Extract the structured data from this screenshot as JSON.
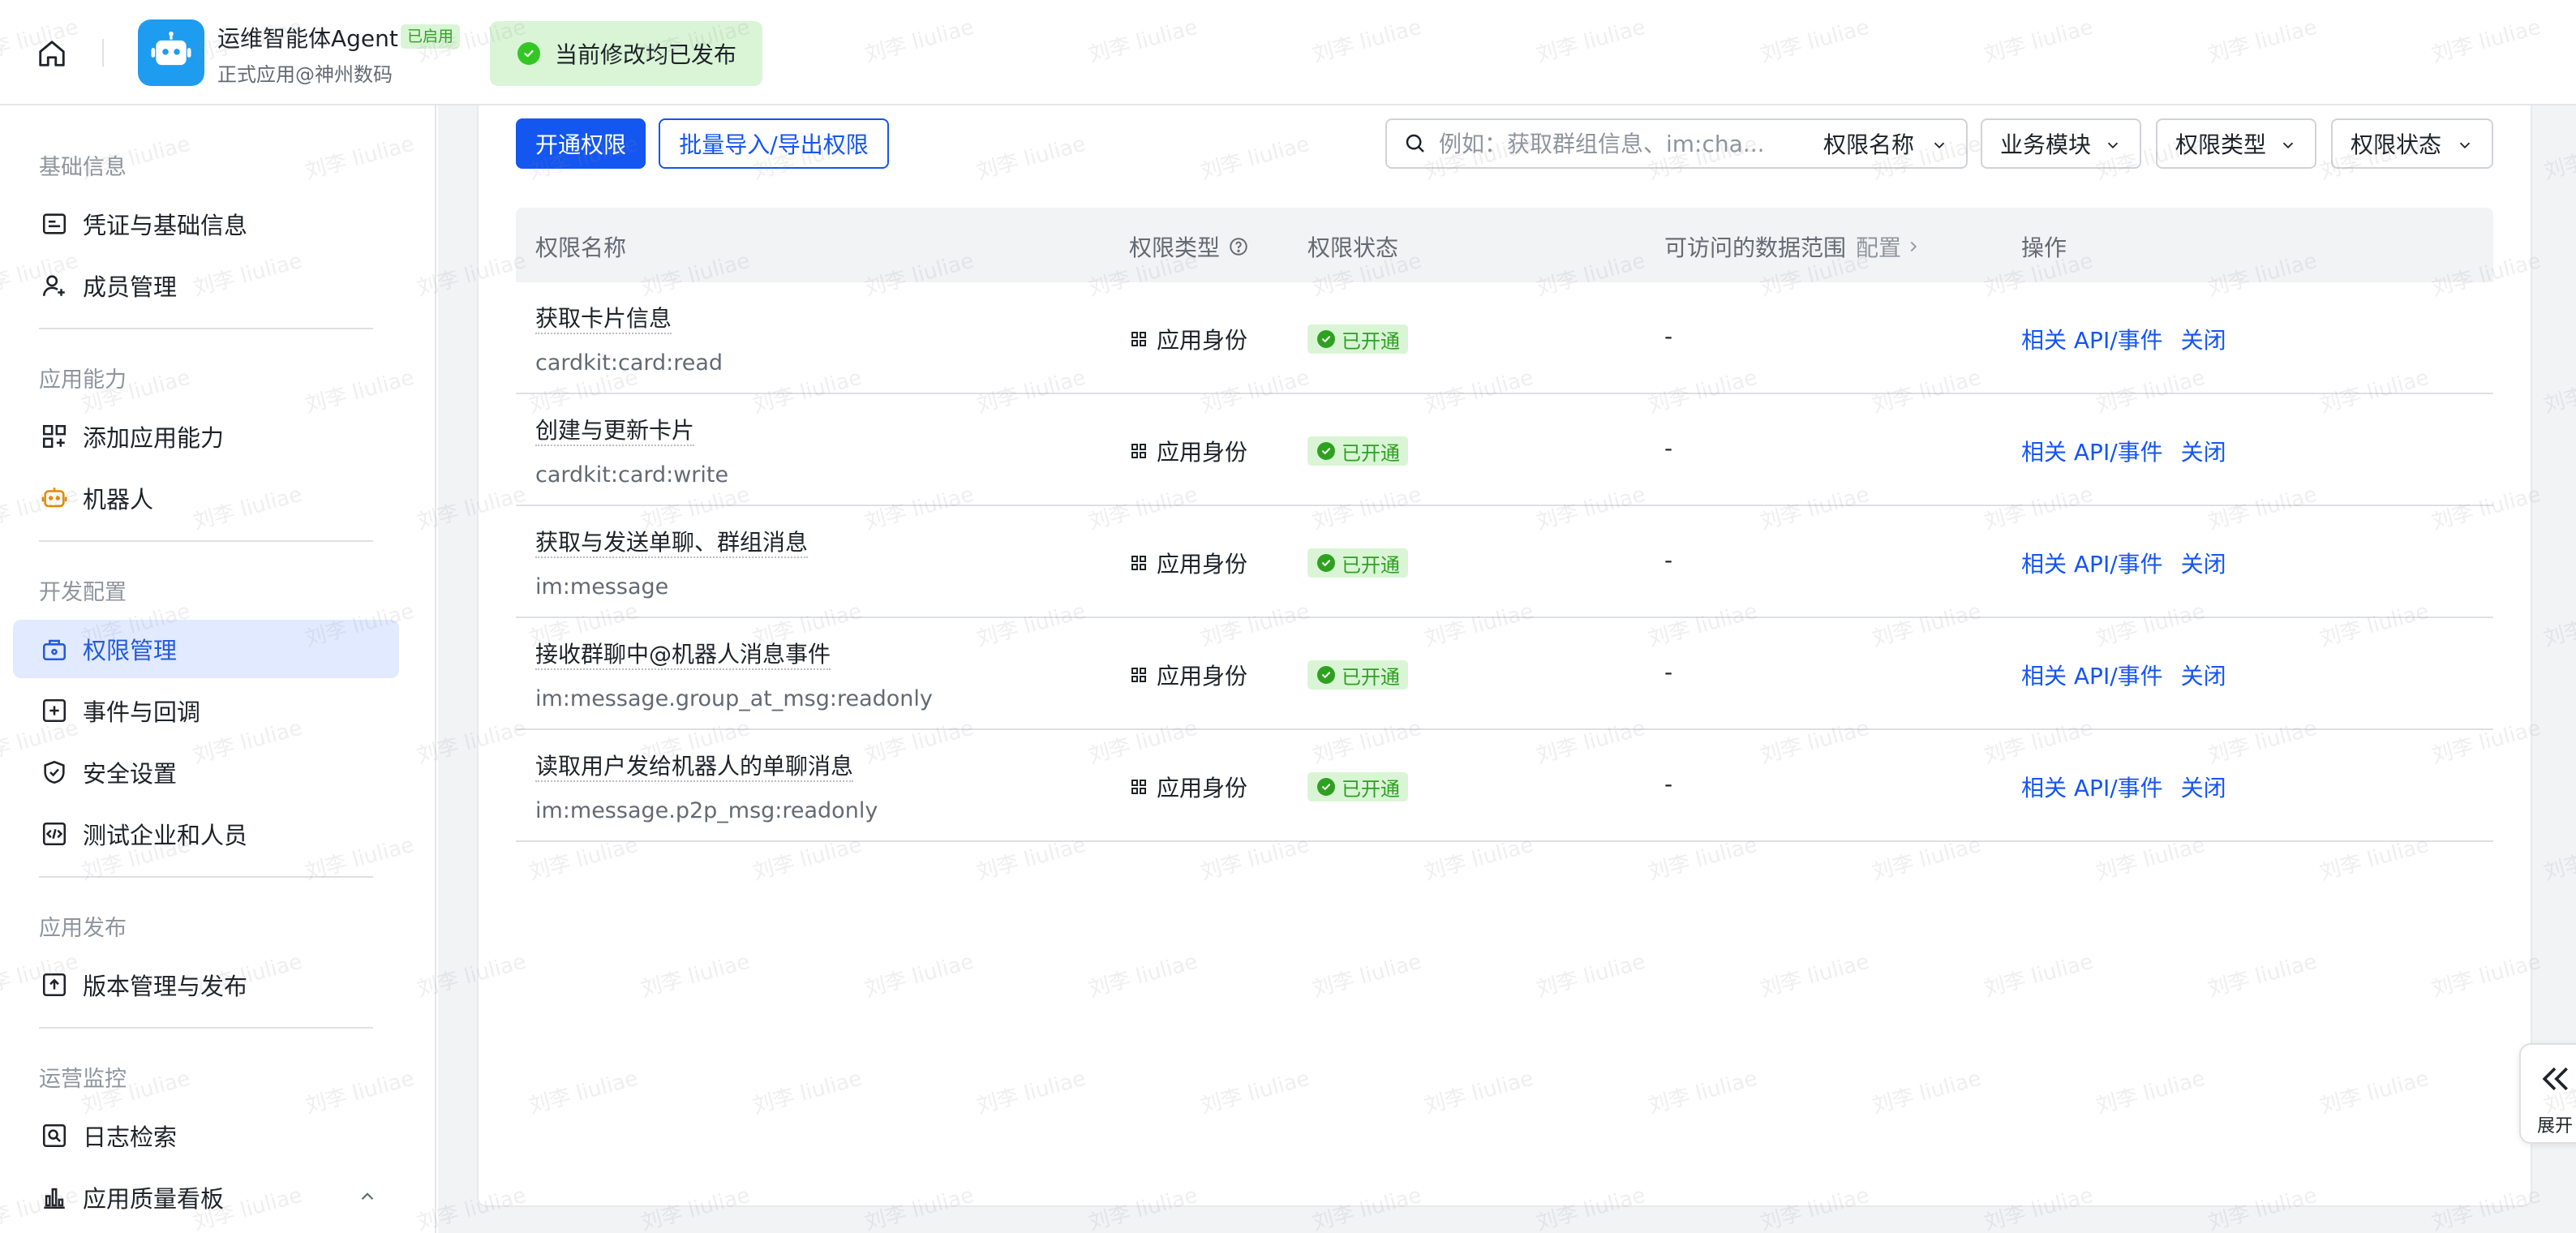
{
  "topbar": {
    "app_name": "运维智能体Agent",
    "app_badge": "已启用",
    "app_sub": "正式应用@神州数码",
    "toast": "当前修改均已发布"
  },
  "sidebar": {
    "groups": [
      {
        "label": "基础信息"
      },
      {
        "label": "应用能力"
      },
      {
        "label": "开发配置"
      },
      {
        "label": "应用发布"
      },
      {
        "label": "运营监控"
      }
    ],
    "items": [
      {
        "label": "凭证与基础信息",
        "icon": "credential-icon"
      },
      {
        "label": "成员管理",
        "icon": "add-member-icon"
      },
      {
        "label": "添加应用能力",
        "icon": "apps-add-icon"
      },
      {
        "label": "机器人",
        "icon": "robot-icon"
      },
      {
        "label": "权限管理",
        "icon": "permission-icon"
      },
      {
        "label": "事件与回调",
        "icon": "event-icon"
      },
      {
        "label": "安全设置",
        "icon": "shield-icon"
      },
      {
        "label": "测试企业和人员",
        "icon": "code-icon"
      },
      {
        "label": "版本管理与发布",
        "icon": "upload-icon"
      },
      {
        "label": "日志检索",
        "icon": "log-search-icon"
      },
      {
        "label": "应用质量看板",
        "icon": "chart-icon"
      }
    ]
  },
  "toolbar": {
    "open_btn": "开通权限",
    "import_btn": "批量导入/导出权限",
    "search_placeholder": "例如：获取群组信息、im:cha...",
    "search_field": "权限名称",
    "filters": [
      "业务模块",
      "权限类型",
      "权限状态"
    ]
  },
  "table": {
    "headers": {
      "name": "权限名称",
      "type": "权限类型",
      "status": "权限状态",
      "scope": "可访问的数据范围",
      "scope_config": "配置",
      "ops": "操作"
    },
    "rows": [
      {
        "name": "获取卡片信息",
        "code": "cardkit:card:read",
        "type": "应用身份",
        "status": "已开通",
        "scope": "-",
        "op_api": "相关 API/事件",
        "op_close": "关闭"
      },
      {
        "name": "创建与更新卡片",
        "code": "cardkit:card:write",
        "type": "应用身份",
        "status": "已开通",
        "scope": "-",
        "op_api": "相关 API/事件",
        "op_close": "关闭"
      },
      {
        "name": "获取与发送单聊、群组消息",
        "code": "im:message",
        "type": "应用身份",
        "status": "已开通",
        "scope": "-",
        "op_api": "相关 API/事件",
        "op_close": "关闭"
      },
      {
        "name": "接收群聊中@机器人消息事件",
        "code": "im:message.group_at_msg:readonly",
        "type": "应用身份",
        "status": "已开通",
        "scope": "-",
        "op_api": "相关 API/事件",
        "op_close": "关闭"
      },
      {
        "name": "读取用户发给机器人的单聊消息",
        "code": "im:message.p2p_msg:readonly",
        "type": "应用身份",
        "status": "已开通",
        "scope": "-",
        "op_api": "相关 API/事件",
        "op_close": "关闭"
      }
    ]
  },
  "expand_panel": {
    "label": "展开"
  },
  "watermark": {
    "text": "刘李 liuliae"
  },
  "colors": {
    "primary": "#1456f0",
    "success": "#2ea121",
    "success_bg": "#d9f5d6",
    "active_bg": "#e1eaff"
  }
}
